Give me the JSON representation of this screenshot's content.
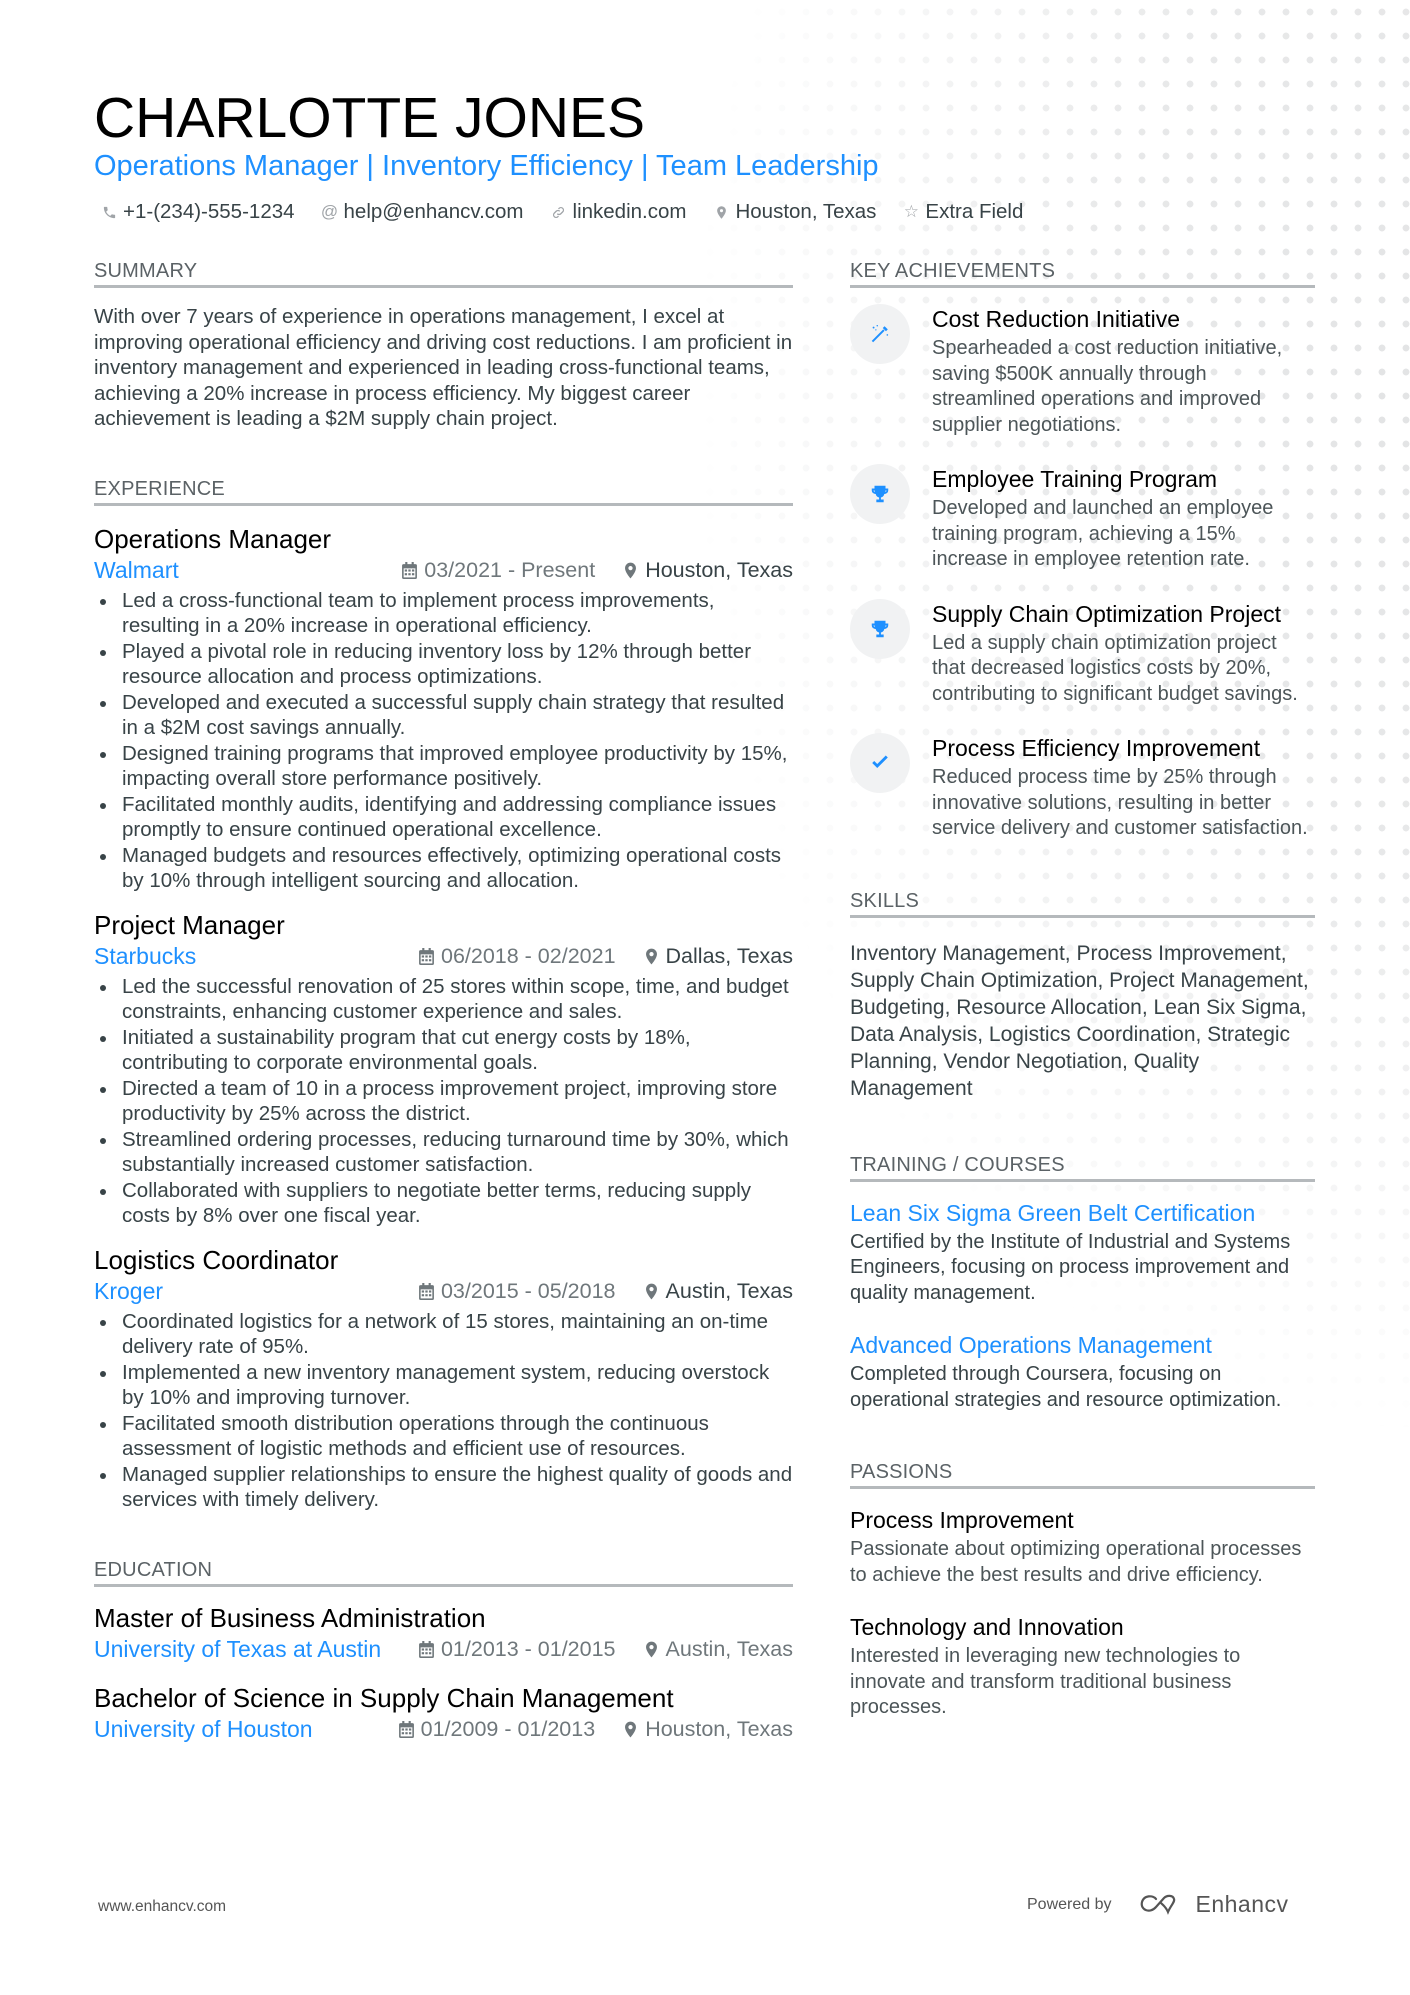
{
  "header": {
    "name": "CHARLOTTE JONES",
    "headline": "Operations Manager | Inventory Efficiency | Team Leadership",
    "contacts": [
      {
        "icon": "phone-icon",
        "text": "+1-(234)-555-1234"
      },
      {
        "icon": "at-icon",
        "text": "help@enhancv.com"
      },
      {
        "icon": "link-icon",
        "text": "linkedin.com"
      },
      {
        "icon": "location-icon",
        "text": "Houston, Texas"
      },
      {
        "icon": "star-icon",
        "text": "Extra Field"
      }
    ]
  },
  "summary": {
    "title": "SUMMARY",
    "text": "With over 7 years of experience in operations management, I excel at improving operational efficiency and driving cost reductions. I am proficient in inventory management and experienced in leading cross-functional teams, achieving a 20% increase in process efficiency. My biggest career achievement is leading a $2M supply chain project."
  },
  "experience": {
    "title": "EXPERIENCE",
    "jobs": [
      {
        "title": "Operations Manager",
        "company": "Walmart",
        "dates": "03/2021 - Present",
        "location": "Houston, Texas",
        "bullets": [
          "Led a cross-functional team to implement process improvements, resulting in a 20% increase in operational efficiency.",
          "Played a pivotal role in reducing inventory loss by 12% through better resource allocation and process optimizations.",
          "Developed and executed a successful supply chain strategy that resulted in a $2M cost savings annually.",
          "Designed training programs that improved employee productivity by 15%, impacting overall store performance positively.",
          "Facilitated monthly audits, identifying and addressing compliance issues promptly to ensure continued operational excellence.",
          "Managed budgets and resources effectively, optimizing operational costs by 10% through intelligent sourcing and allocation."
        ]
      },
      {
        "title": "Project Manager",
        "company": "Starbucks",
        "dates": "06/2018 - 02/2021",
        "location": "Dallas, Texas",
        "bullets": [
          "Led the successful renovation of 25 stores within scope, time, and budget constraints, enhancing customer experience and sales.",
          "Initiated a sustainability program that cut energy costs by 18%, contributing to corporate environmental goals.",
          "Directed a team of 10 in a process improvement project, improving store productivity by 25% across the district.",
          "Streamlined ordering processes, reducing turnaround time by 30%, which substantially increased customer satisfaction.",
          "Collaborated with suppliers to negotiate better terms, reducing supply costs by 8% over one fiscal year."
        ]
      },
      {
        "title": "Logistics Coordinator",
        "company": "Kroger",
        "dates": "03/2015 - 05/2018",
        "location": "Austin, Texas",
        "bullets": [
          "Coordinated logistics for a network of 15 stores, maintaining an on-time delivery rate of 95%.",
          "Implemented a new inventory management system, reducing overstock by 10% and improving turnover.",
          "Facilitated smooth distribution operations through the continuous assessment of logistic methods and efficient use of resources.",
          "Managed supplier relationships to ensure the highest quality of goods and services with timely delivery."
        ]
      }
    ]
  },
  "education": {
    "title": "EDUCATION",
    "items": [
      {
        "degree": "Master of Business Administration",
        "school": "University of Texas at Austin",
        "dates": "01/2013 - 01/2015",
        "location": "Austin, Texas"
      },
      {
        "degree": "Bachelor of Science in Supply Chain Management",
        "school": "University of Houston",
        "dates": "01/2009 - 01/2013",
        "location": "Houston, Texas"
      }
    ]
  },
  "achievements": {
    "title": "KEY ACHIEVEMENTS",
    "items": [
      {
        "icon": "magic-wand-icon",
        "title": "Cost Reduction Initiative",
        "desc": "Spearheaded a cost reduction initiative, saving $500K annually through streamlined operations and improved supplier negotiations."
      },
      {
        "icon": "trophy-icon",
        "title": "Employee Training Program",
        "desc": "Developed and launched an employee training program, achieving a 15% increase in employee retention rate."
      },
      {
        "icon": "trophy-icon",
        "title": "Supply Chain Optimization Project",
        "desc": "Led a supply chain optimization project that decreased logistics costs by 20%, contributing to significant budget savings."
      },
      {
        "icon": "checkmark-icon",
        "title": "Process Efficiency Improvement",
        "desc": "Reduced process time by 25% through innovative solutions, resulting in better service delivery and customer satisfaction."
      }
    ]
  },
  "skills": {
    "title": "SKILLS",
    "text": "Inventory Management, Process Improvement, Supply Chain Optimization, Project Management, Budgeting, Resource Allocation, Lean Six Sigma, Data Analysis, Logistics Coordination, Strategic Planning, Vendor Negotiation, Quality Management"
  },
  "training": {
    "title": "TRAINING / COURSES",
    "items": [
      {
        "title": "Lean Six Sigma Green Belt Certification",
        "desc": "Certified by the Institute of Industrial and Systems Engineers, focusing on process improvement and quality management."
      },
      {
        "title": "Advanced Operations Management",
        "desc": "Completed through Coursera, focusing on operational strategies and resource optimization."
      }
    ]
  },
  "passions": {
    "title": "PASSIONS",
    "items": [
      {
        "title": "Process Improvement",
        "desc": "Passionate about optimizing operational processes to achieve the best results and drive efficiency."
      },
      {
        "title": "Technology and Innovation",
        "desc": "Interested in leveraging new technologies to innovate and transform traditional business processes."
      }
    ]
  },
  "footer": {
    "website": "www.enhancv.com",
    "powered_by": "Powered by",
    "brand": "Enhancv"
  },
  "colors": {
    "accent": "#1e90ff",
    "text": "#384347",
    "rule": "#b5b9bc"
  }
}
